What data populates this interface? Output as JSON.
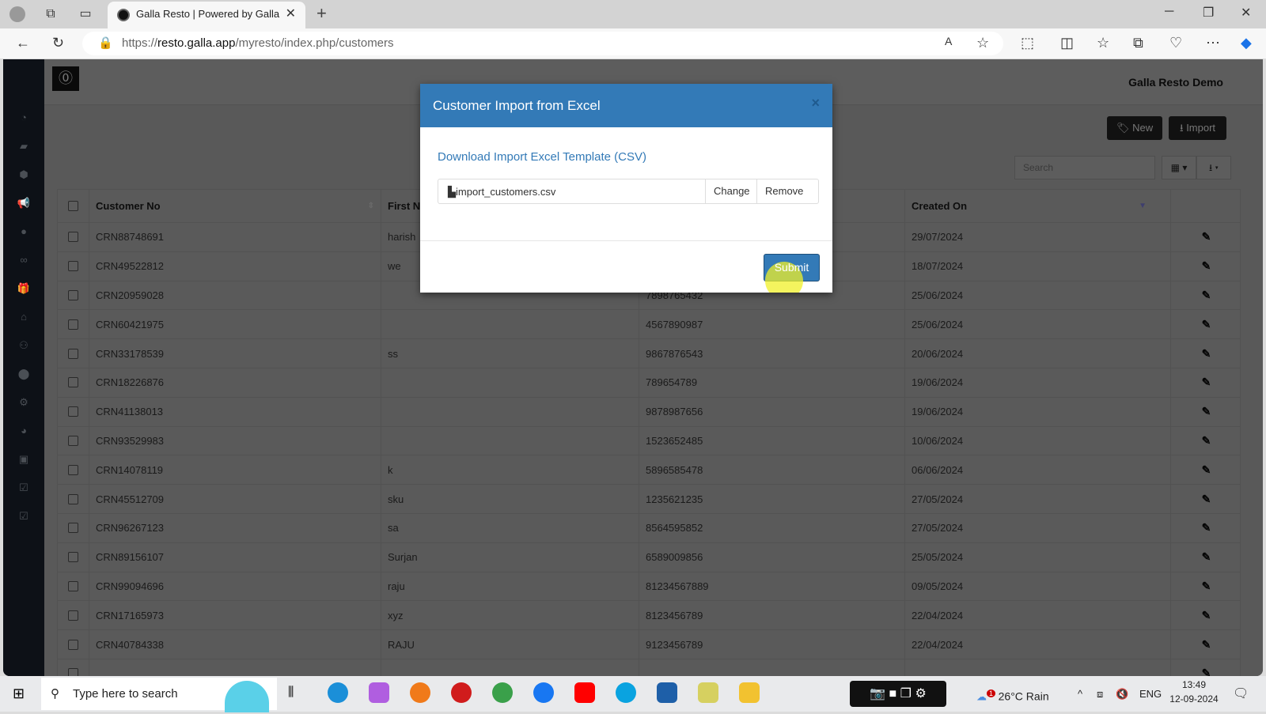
{
  "browser": {
    "tab_title": "Galla Resto | Powered by Galla",
    "url_prefix": "https://",
    "url_host": "resto.galla.app",
    "url_path": "/myresto/index.php/customers"
  },
  "app": {
    "brand": "Galla Resto Demo",
    "new_label": "New",
    "import_label": "Import",
    "search_placeholder": "Search"
  },
  "sidebar": {
    "icons": [
      "dashboard-icon",
      "folder-icon",
      "cube-icon",
      "megaphone-icon",
      "user-icon",
      "handshake-icon",
      "gift-icon",
      "basket-icon",
      "users-icon",
      "map-marker-icon",
      "gear-icon",
      "pie-chart-icon",
      "money-icon",
      "check-square-icon",
      "check-square-icon"
    ]
  },
  "table": {
    "headers": [
      "Customer No",
      "First N",
      "",
      "",
      "Created On"
    ],
    "rows": [
      [
        "CRN88748691",
        "harish",
        "",
        "",
        "29/07/2024"
      ],
      [
        "CRN49522812",
        "we",
        "",
        "",
        "18/07/2024"
      ],
      [
        "CRN20959028",
        "",
        "",
        "7898765432",
        "25/06/2024"
      ],
      [
        "CRN60421975",
        "",
        "",
        "4567890987",
        "25/06/2024"
      ],
      [
        "CRN33178539",
        "ss",
        "",
        "9867876543",
        "20/06/2024"
      ],
      [
        "CRN18226876",
        "",
        "",
        "789654789",
        "19/06/2024"
      ],
      [
        "CRN41138013",
        "",
        "",
        "9878987656",
        "19/06/2024"
      ],
      [
        "CRN93529983",
        "",
        "",
        "1523652485",
        "10/06/2024"
      ],
      [
        "CRN14078119",
        "k",
        "",
        "5896585478",
        "06/06/2024"
      ],
      [
        "CRN45512709",
        "sku",
        "",
        "1235621235",
        "27/05/2024"
      ],
      [
        "CRN96267123",
        "sa",
        "",
        "8564595852",
        "27/05/2024"
      ],
      [
        "CRN89156107",
        "Surjan",
        "",
        "6589009856",
        "25/05/2024"
      ],
      [
        "CRN99094696",
        "raju",
        "",
        "81234567889",
        "09/05/2024"
      ],
      [
        "CRN17165973",
        "xyz",
        "",
        "8123456789",
        "22/04/2024"
      ],
      [
        "CRN40784338",
        "RAJU",
        "",
        "9123456789",
        "22/04/2024"
      ]
    ]
  },
  "modal": {
    "title": "Customer Import from Excel",
    "close": "×",
    "download_link": "Download Import Excel Template (CSV)",
    "file_name": "import_customers.csv",
    "change_label": "Change",
    "remove_label": "Remove",
    "submit_label": "Submit"
  },
  "taskbar": {
    "search_placeholder": "Type here to search",
    "weather": "26°C  Rain",
    "weather_badge": "1",
    "lang": "ENG",
    "time": "13:49",
    "date": "12-09-2024"
  },
  "colors": {
    "primary": "#337ab7",
    "sidebar": "#222d32"
  }
}
